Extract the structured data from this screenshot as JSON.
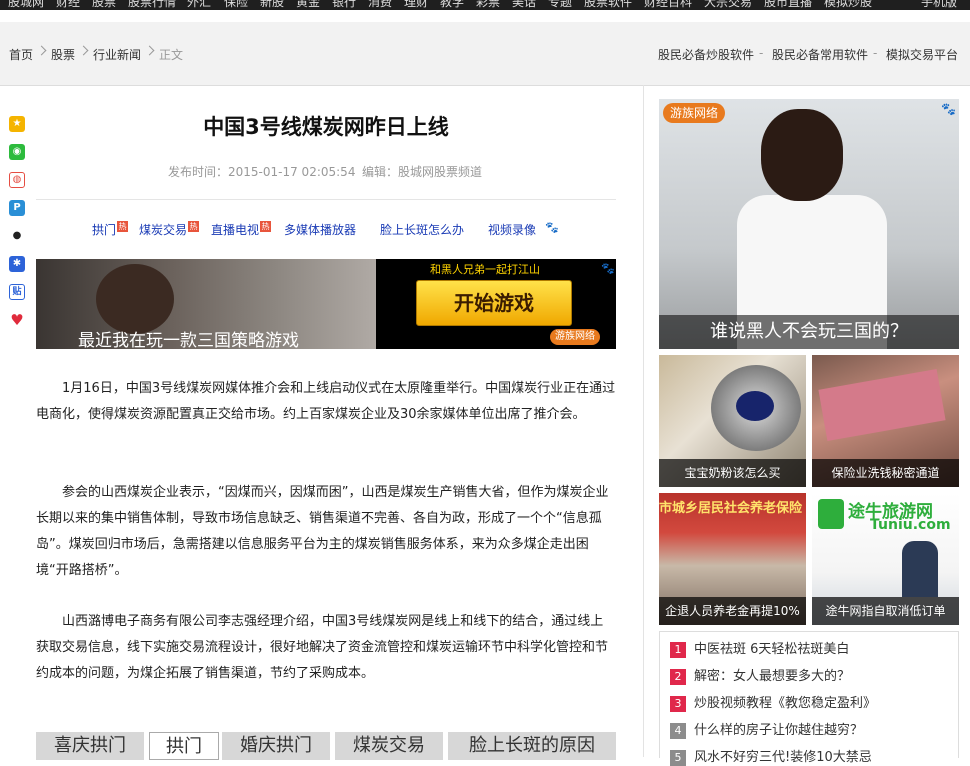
{
  "topnav": [
    "股城网",
    "财经",
    "股票",
    "股票行情",
    "外汇",
    "保险",
    "新股",
    "黄金",
    "银行",
    "消费",
    "理财",
    "教学",
    "彩票",
    "美话",
    "专题",
    "股票软件",
    "财经百科",
    "大宗交易",
    "股市直播",
    "模拟炒股",
    "手机版"
  ],
  "breadcrumb": [
    "首页",
    "股票",
    "行业新闻",
    "正文"
  ],
  "right_links": [
    "股民必备炒股软件",
    "股民必备常用软件",
    "模拟交易平台"
  ],
  "share_icons": [
    "qzone-icon",
    "wechat-icon",
    "weibo-icon",
    "tencent-weibo-icon",
    "qq-icon",
    "baidu-icon",
    "renren-icon",
    "favorite-icon"
  ],
  "article": {
    "title": "中国3号线煤炭网昨日上线",
    "time_label": "发布时间：2015-01-17 02:05:54",
    "editor_label": "编辑：股城网股票频道",
    "tags": [
      "拱门",
      "煤炭交易",
      "直播电视",
      "多媒体播放器",
      "脸上长斑怎么办",
      "视频录像"
    ],
    "hot_badge": "热",
    "paragraphs": [
      "1月16日，中国3号线煤炭网媒体推介会和上线启动仪式在太原隆重举行。中国煤炭行业正在通过电商化，使得煤炭资源配置真正交给市场。约上百家煤炭企业及30余家媒体单位出席了推介会。",
      "参会的山西煤炭企业表示，“因煤而兴，因煤而困”，山西是煤炭生产销售大省，但作为煤炭企业长期以来的集中销售体制，导致市场信息缺乏、销售渠道不完善、各自为政，形成了一个个“信息孤岛”。煤炭回归市场后，急需搭建以信息服务平台为主的煤炭销售服务体系，来为众多煤企走出困境“开路搭桥”。",
      "山西潞博电子商务有限公司李志强经理介绍，中国3号线煤炭网是线上和线下的结合，通过线上获取交易信息，线下实施交易流程设计，很好地解决了资金流管控和煤炭运输环节中科学化管控和节约成本的问题，为煤企拓展了销售渠道，节约了采购成本。"
    ]
  },
  "banner": {
    "caption": "最近我在玩一款三国策略游戏",
    "slogan": "和黑人兄弟一起打江山",
    "button": "开始游戏",
    "brand": "游族网络"
  },
  "bottom_tabs": [
    "喜庆拱门",
    "拱门",
    "婚庆拱门",
    "煤炭交易",
    "脸上长斑的原因"
  ],
  "right_ad": {
    "brand": "游族网络",
    "caption": "谁说黑人不会玩三国的？"
  },
  "thumbs": [
    "宝宝奶粉该怎么买",
    "保险业洗钱秘密通道",
    "企退人员养老金再提10%",
    "途牛网指自取消低订单"
  ],
  "thumb_texts": {
    "tuniu": "途牛旅游网",
    "tuniu_en": "Tuniu.com",
    "pension": "市城乡居民社会养老保险"
  },
  "ranked_list": [
    {
      "n": "1",
      "text": "中医祛斑 6天轻松祛斑美白",
      "color": "#e0284b"
    },
    {
      "n": "2",
      "text": "解密：女人最想要多大的？",
      "color": "#e0284b"
    },
    {
      "n": "3",
      "text": "炒股视频教程《教您稳定盈利》",
      "color": "#e0284b"
    },
    {
      "n": "4",
      "text": "什么样的房子让你越住越穷？",
      "color": "#8c8c8c"
    },
    {
      "n": "5",
      "text": "风水不好穷三代!装修10大禁忌",
      "color": "#8c8c8c"
    }
  ]
}
